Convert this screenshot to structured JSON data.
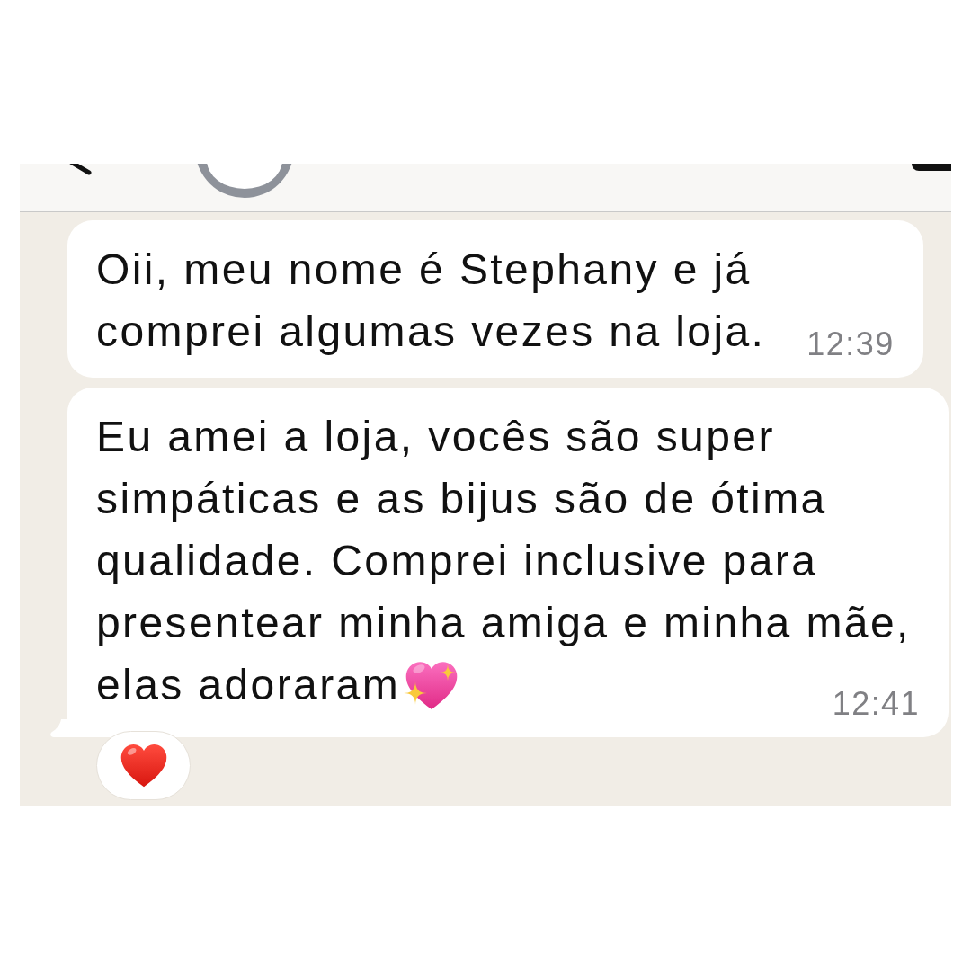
{
  "messages": [
    {
      "lines": [
        "Oii, meu nome é Stephany e já",
        "comprei algumas vezes na loja."
      ],
      "time": "12:39",
      "tail": false
    },
    {
      "lines": [
        "Eu amei a loja, vocês são super",
        "simpáticas e as bijus são de ótima",
        "qualidade. Comprei inclusive para",
        "presentear minha amiga e minha mãe,",
        "elas adoraram"
      ],
      "time": "12:41",
      "tail": true,
      "emoji": {
        "kind": "sparkling_heart"
      },
      "reaction": {
        "kind": "heart"
      }
    }
  ]
}
